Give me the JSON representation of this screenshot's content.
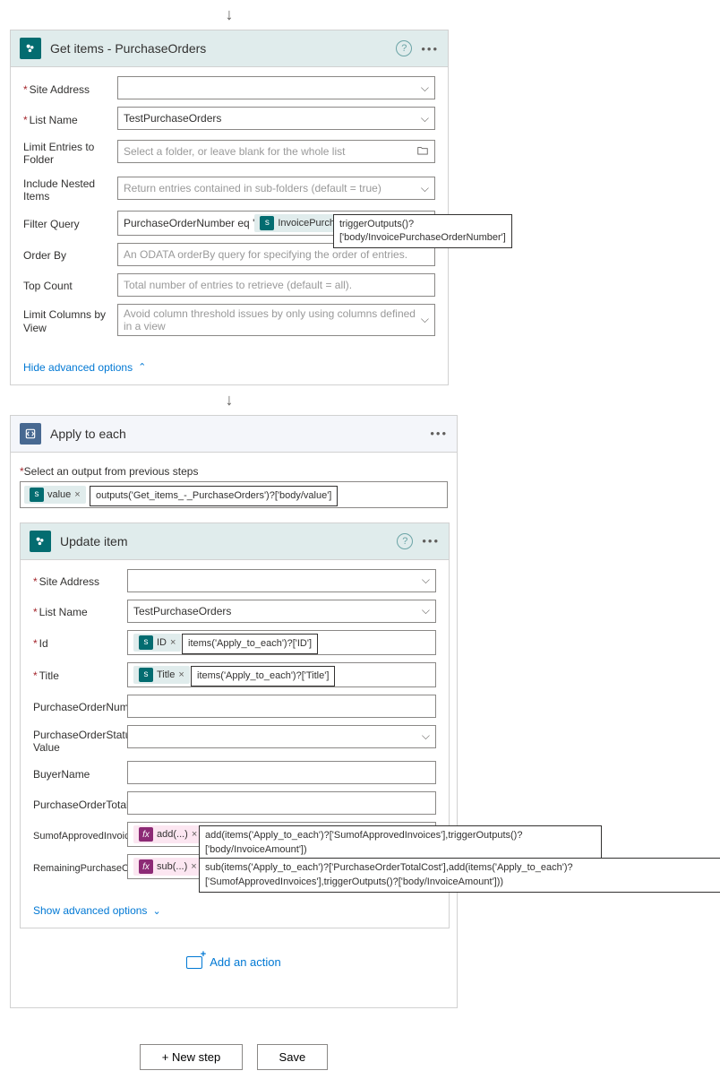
{
  "arrow": "↓",
  "getItems": {
    "title": "Get items - PurchaseOrders",
    "fields": {
      "siteAddress": {
        "label": "Site Address",
        "value": ""
      },
      "listName": {
        "label": "List Name",
        "value": "TestPurchaseOrders"
      },
      "limitFolder": {
        "label": "Limit Entries to Folder",
        "placeholder": "Select a folder, or leave blank for the whole list"
      },
      "includeNested": {
        "label": "Include Nested Items",
        "placeholder": "Return entries contained in sub-folders (default = true)"
      },
      "filterQuery": {
        "label": "Filter Query",
        "prefix": "PurchaseOrderNumber eq '",
        "token": "InvoicePurchas...",
        "expression": "triggerOutputs()?['body/InvoicePurchaseOrderNumber']"
      },
      "orderBy": {
        "label": "Order By",
        "placeholder": "An ODATA orderBy query for specifying the order of entries."
      },
      "topCount": {
        "label": "Top Count",
        "placeholder": "Total number of entries to retrieve (default = all)."
      },
      "limitColumns": {
        "label": "Limit Columns by View",
        "placeholder": "Avoid column threshold issues by only using columns defined in a view"
      }
    },
    "toggle": "Hide advanced options"
  },
  "applyEach": {
    "title": "Apply to each",
    "selectLabel": "Select an output from previous steps",
    "token": "value",
    "expression": "outputs('Get_items_-_PurchaseOrders')?['body/value']"
  },
  "updateItem": {
    "title": "Update item",
    "fields": {
      "siteAddress": {
        "label": "Site Address"
      },
      "listName": {
        "label": "List Name",
        "value": "TestPurchaseOrders"
      },
      "id": {
        "label": "Id",
        "token": "ID",
        "expression": "items('Apply_to_each')?['ID']"
      },
      "title": {
        "label": "Title",
        "token": "Title",
        "expression": "items('Apply_to_each')?['Title']"
      },
      "poNumber": {
        "label": "PurchaseOrderNumber"
      },
      "poStatus": {
        "label": "PurchaseOrderStatus Value"
      },
      "buyer": {
        "label": "BuyerName"
      },
      "poTotal": {
        "label": "PurchaseOrderTotalCost"
      },
      "sumApproved": {
        "label": "SumofApprovedInvoices",
        "token": "add(...)",
        "expression": "add(items('Apply_to_each')?['SumofApprovedInvoices'],triggerOutputs()?['body/InvoiceAmount'])"
      },
      "remaining": {
        "label": "RemainingPurchaseOrder",
        "token": "sub(...)",
        "expression": "sub(items('Apply_to_each')?['PurchaseOrderTotalCost'],add(items('Apply_to_each')?['SumofApprovedInvoices'],triggerOutputs()?['body/InvoiceAmount']))"
      }
    },
    "toggle": "Show advanced options"
  },
  "addAction": "Add an action",
  "buttons": {
    "newStep": "+ New step",
    "save": "Save"
  }
}
